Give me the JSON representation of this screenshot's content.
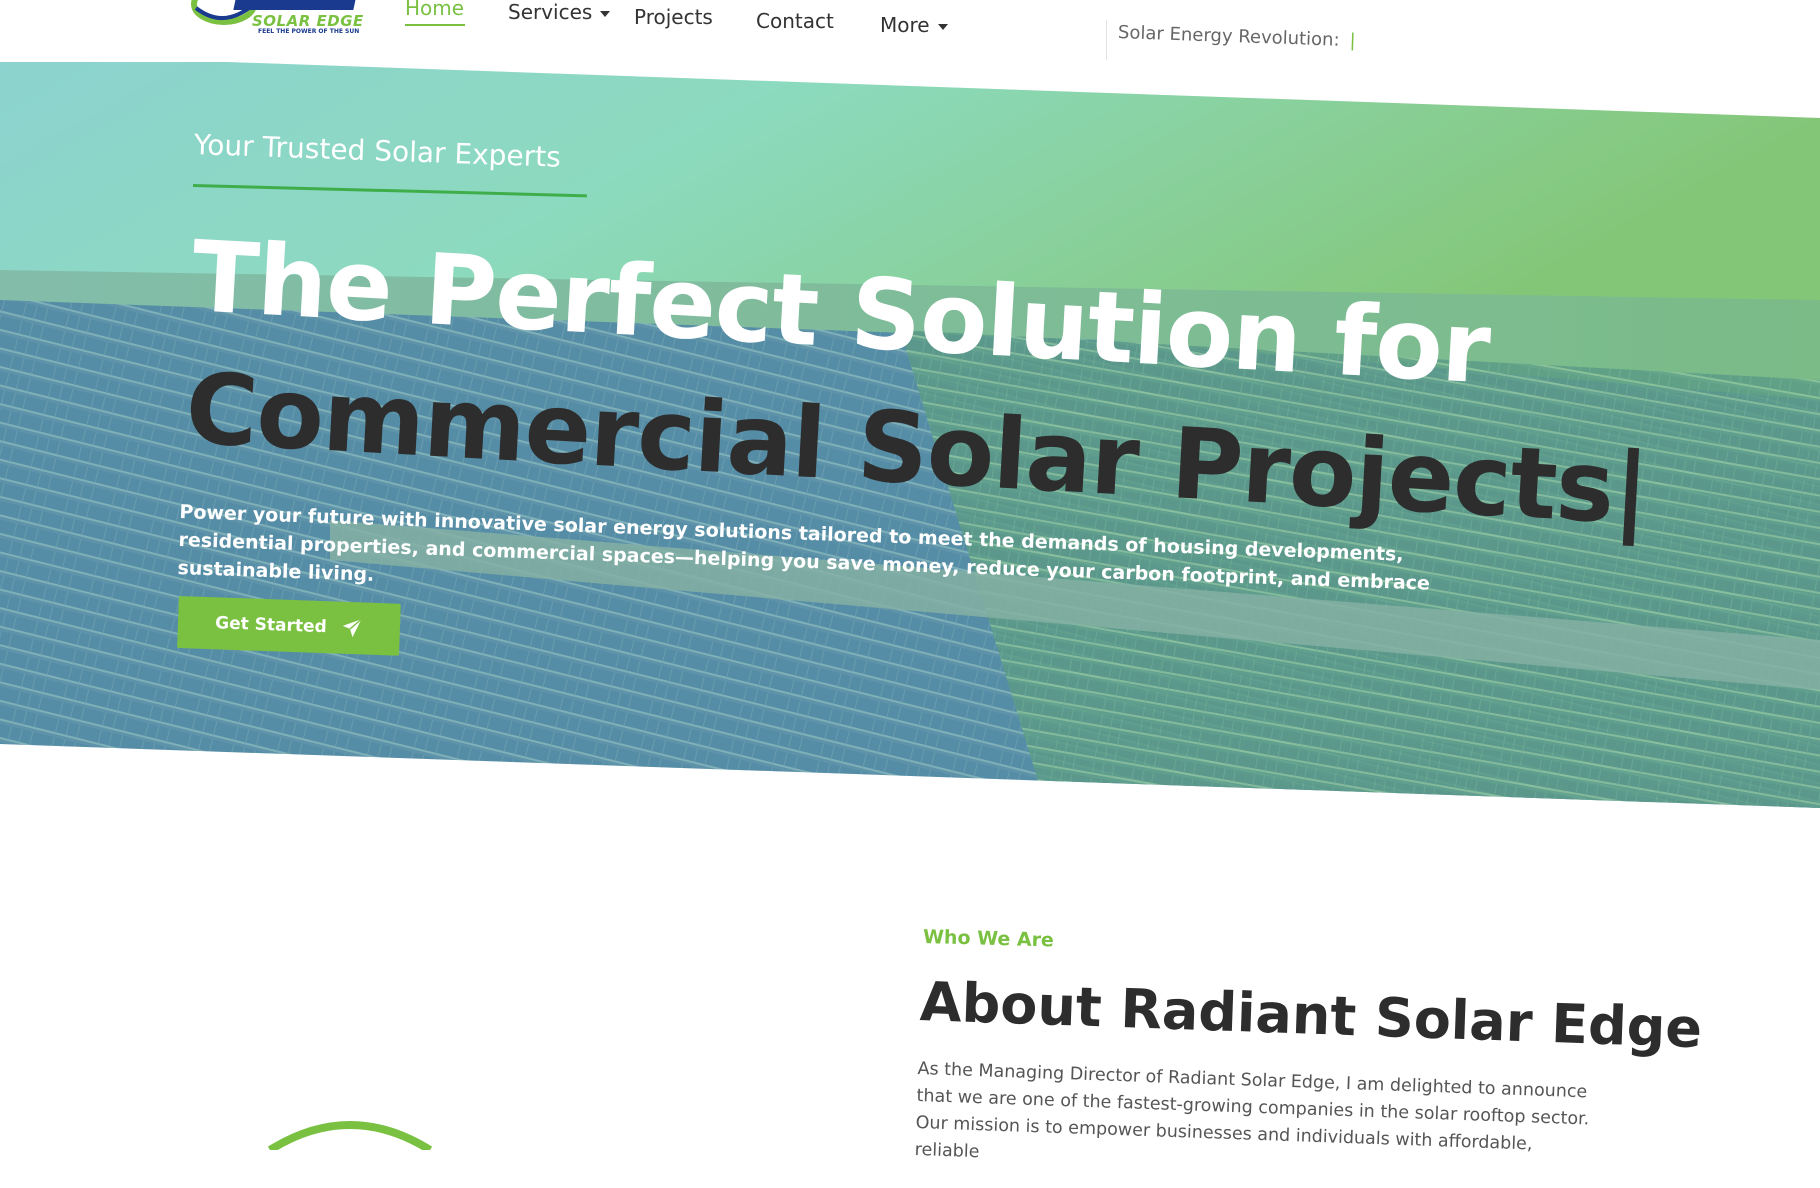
{
  "brand": {
    "logo_name": "RADIANT",
    "logo_sub": "SOLAR EDGE",
    "logo_tagline": "FEEL THE POWER OF THE SUN",
    "accent_color": "#7ac142",
    "dark_color": "#2d2d2d"
  },
  "nav": {
    "items": [
      {
        "label": "Home",
        "active": true
      },
      {
        "label": "Services",
        "has_dropdown": true
      },
      {
        "label": "Projects"
      },
      {
        "label": "Contact"
      },
      {
        "label": "More",
        "has_dropdown": true
      }
    ],
    "tagline": "Solar Energy Revolution:",
    "tagline_cursor": "|"
  },
  "hero": {
    "eyebrow": "Your Trusted Solar Experts",
    "title_line1": "The Perfect Solution for",
    "title_line2": "Commercial Solar Projects|",
    "description": "Power your future with innovative solar energy solutions tailored to meet the demands of housing developments, residential properties, and commercial spaces—helping you save money, reduce your carbon footprint, and embrace sustainable living.",
    "cta_label": "Get Started",
    "cta_icon": "paper-plane-icon",
    "overlay_colors": [
      "#8fd8c7",
      "#7ac142",
      "#3d7fb8"
    ]
  },
  "about": {
    "eyebrow": "Who We Are",
    "title": "About Radiant Solar Edge",
    "body": "As the Managing Director of Radiant Solar Edge, I am delighted to announce that we are one of the fastest-growing companies in the solar rooftop sector. Our mission is to empower businesses and individuals with affordable, reliable"
  }
}
